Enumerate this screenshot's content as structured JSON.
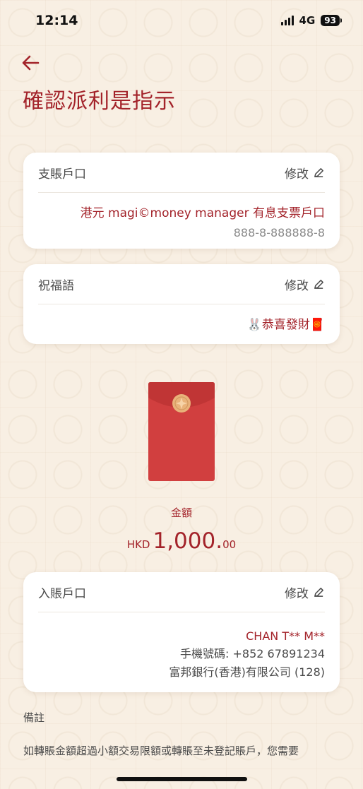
{
  "status": {
    "time": "12:14",
    "network": "4G",
    "battery": "93"
  },
  "header": {
    "back_icon": "arrow-left-icon",
    "title": "確認派利是指示"
  },
  "debit_account": {
    "label": "支賬戶口",
    "edit_label": "修改",
    "account_name": "港元 magi©money manager 有息支票戶口",
    "account_number": "888-8-888888-8"
  },
  "greeting": {
    "label": "祝福語",
    "edit_label": "修改",
    "message": "🐰恭喜發財🧧"
  },
  "amount": {
    "label": "金額",
    "currency": "HKD",
    "value": "1,000.",
    "cents": "00"
  },
  "credit_account": {
    "label": "入賬戶口",
    "edit_label": "修改",
    "payee_name": "CHAN T** M**",
    "phone": "手機號碼: +852 67891234",
    "bank": "富邦銀行(香港)有限公司 (128)"
  },
  "remarks": {
    "title": "備註",
    "text": "如轉賬金額超過小額交易限額或轉賬至未登記賬戶，您需要"
  },
  "colors": {
    "accent": "#a3232a",
    "envelope": "#d13f3f",
    "background": "#f7ede0"
  }
}
